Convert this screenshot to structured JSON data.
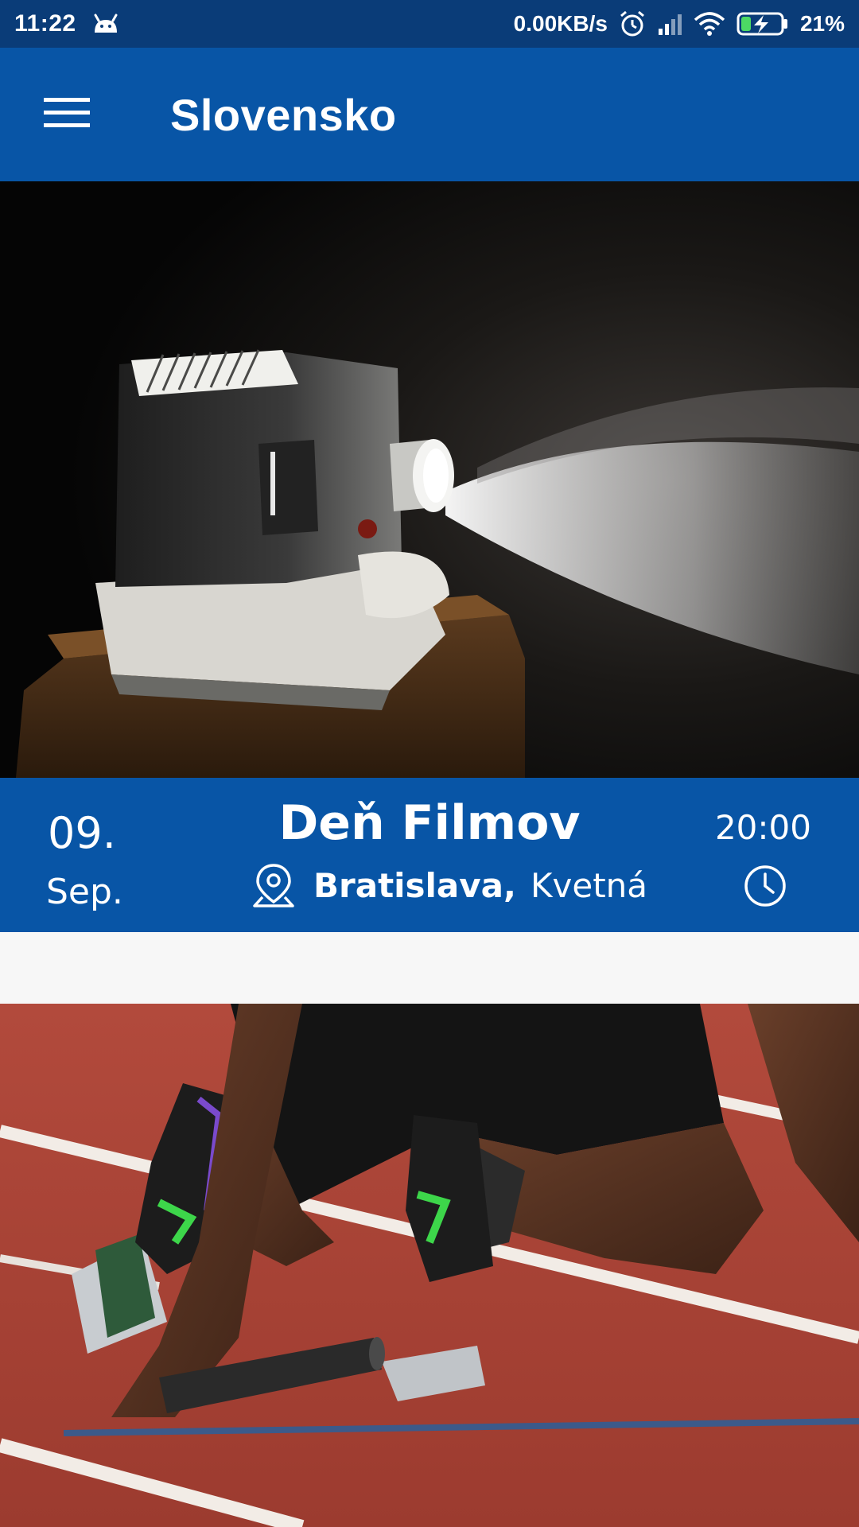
{
  "status_bar": {
    "time": "11:22",
    "network_speed": "0.00KB/s",
    "battery": "21%",
    "icons": [
      "android-notification-icon",
      "alarm-icon",
      "signal-icon",
      "wifi-icon",
      "battery-charging-icon"
    ]
  },
  "app_bar": {
    "title": "Slovensko",
    "menu_icon": "hamburger-menu-icon"
  },
  "events": [
    {
      "image": "film-projector-photo",
      "day": "09.",
      "month": "Sep.",
      "title": "Deň Filmov",
      "city": "Bratislava,",
      "street": "Kvetná",
      "time": "20:00",
      "icons": [
        "location-pin-icon",
        "clock-icon"
      ]
    },
    {
      "image": "sprinter-starting-blocks-photo"
    }
  ],
  "colors": {
    "status_bar": "#0a3c78",
    "app_bar": "#0855a6",
    "event_info": "#0855a6",
    "background": "#f7f7f7"
  }
}
